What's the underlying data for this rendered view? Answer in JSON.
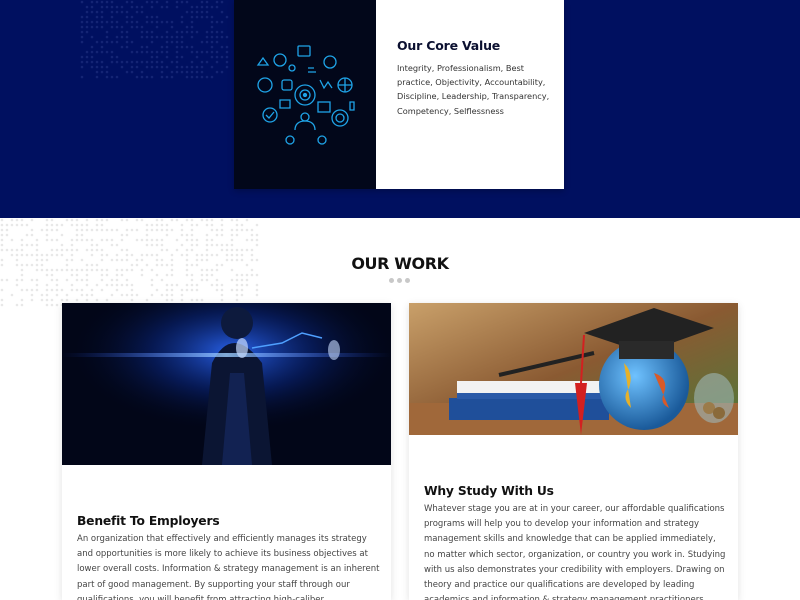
{
  "core_value": {
    "title": "Our Core Value",
    "body": "Integrity, Professionalism, Best practice, Objectivity, Accountability, Discipline, Leadership, Transparency, Competency, Selflessness"
  },
  "work": {
    "title": "OUR WORK",
    "cards": [
      {
        "title": "Benefit To Employers",
        "body": "An organization that effectively and efficiently manages its strategy and opportunities is more likely to achieve its business objectives at lower overall costs. Information & strategy management is an inherent part of good management. By supporting your staff through our qualifications, you will benefit from attracting high-caliber professionals by investing"
      },
      {
        "title": "Why Study With Us",
        "body": "Whatever stage you are at in your career, our affordable qualifications programs will help you to develop your information and strategy management skills and knowledge that can be applied immediately, no matter which sector, organization, or country you work in. Studying with us also demonstrates your credibility with employers. Drawing on theory and practice our qualifications are developed by leading academics and information & strategy management practitioners across the"
      }
    ]
  },
  "colors": {
    "navy": "#001060",
    "icon_blue": "#1fa4e8"
  }
}
